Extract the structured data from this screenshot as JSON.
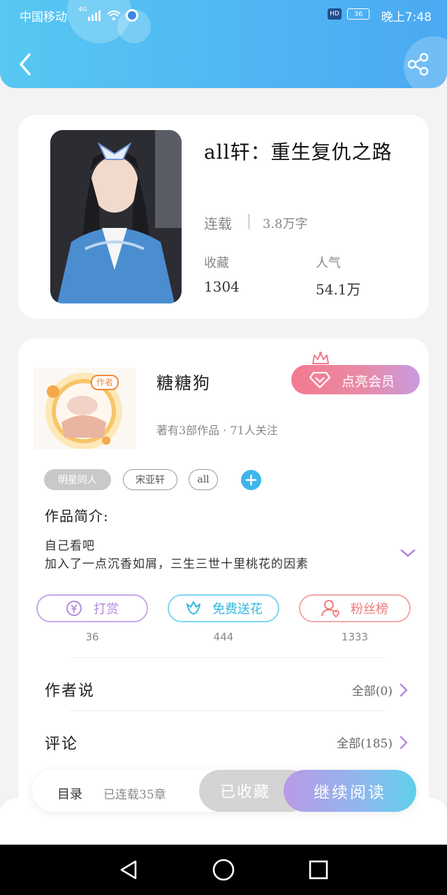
{
  "status_bar": {
    "carrier": "中国移动",
    "network": "4G",
    "battery": "36",
    "time": "晚上7:48"
  },
  "header": {
    "back_icon": "chevron-left-icon",
    "share_icon": "share-icon",
    "accent_color": "#4fb5f3"
  },
  "book": {
    "title": "all轩：重生复仇之路",
    "status": "连载",
    "word_count": "3.8万字",
    "favorites_label": "收藏",
    "favorites_value": "1304",
    "popularity_label": "人气",
    "popularity_value": "54.1万"
  },
  "author": {
    "badge": "作者",
    "name": "糖糖狗",
    "meta": "著有3部作品 · 71人关注",
    "vip_button": "点亮会员"
  },
  "tags": [
    "明星同人",
    "宋亚轩",
    "all"
  ],
  "intro": {
    "label": "作品简介:",
    "lines": [
      "自己看吧",
      "加入了一点沉香如屑，三生三世十里桃花的因素"
    ]
  },
  "actions": [
    {
      "label": "打赏",
      "count": "36",
      "color": "#b48be0",
      "icon": "yuan-coin-icon"
    },
    {
      "label": "免费送花",
      "count": "444",
      "color": "#45c5e8",
      "icon": "flower-icon"
    },
    {
      "label": "粉丝榜",
      "count": "1333",
      "color": "#ef7b7b",
      "icon": "fan-user-icon"
    }
  ],
  "sections": {
    "author_says": {
      "title": "作者说",
      "link": "全部(0)"
    },
    "comments": {
      "title": "评论",
      "link": "全部(185)"
    }
  },
  "bottom_bar": {
    "toc": "目录",
    "chapters": "已连载35章",
    "favorited": "已收藏",
    "continue": "继续阅读"
  }
}
